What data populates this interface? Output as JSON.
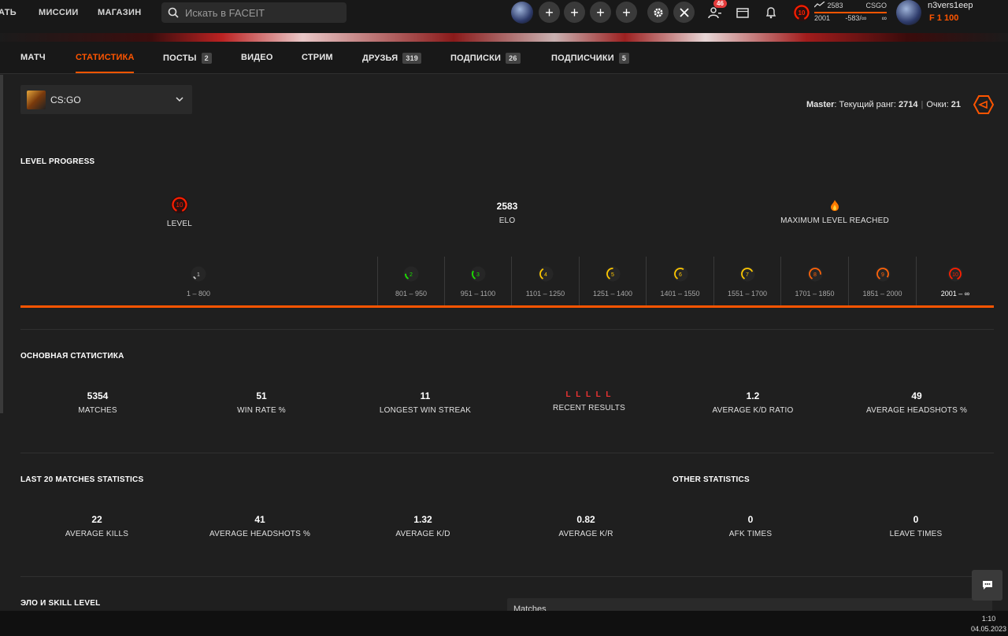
{
  "topnav": {
    "items": [
      "АТЬ",
      "МИССИИ",
      "МАГАЗИН"
    ]
  },
  "search": {
    "placeholder": "Искать в FACEIT"
  },
  "header": {
    "friends_badge": "46",
    "elo_mini": {
      "elo": "2583",
      "game": "CSGO",
      "level_min": "2001",
      "diff": "-583/∞",
      "inf": "∞",
      "level": "10"
    },
    "username": "n3vers1eep",
    "points": "1 100"
  },
  "tabs": [
    {
      "label": "МАТЧ"
    },
    {
      "label": "СТАТИСТИКА",
      "active": true
    },
    {
      "label": "ПОСТЫ",
      "count": "2"
    },
    {
      "label": "ВИДЕО"
    },
    {
      "label": "СТРИМ"
    },
    {
      "label": "ДРУЗЬЯ",
      "count": "319"
    },
    {
      "label": "ПОДПИСКИ",
      "count": "26"
    },
    {
      "label": "ПОДПИСЧИКИ",
      "count": "5"
    }
  ],
  "game_select": {
    "value": "CS:GO"
  },
  "rank": {
    "title": "Master",
    "current_label": "Текущий ранг:",
    "current": "2714",
    "points_label": "Очки:",
    "points": "21"
  },
  "level_progress": {
    "title": "LEVEL PROGRESS",
    "level_value": "10",
    "level_label": "LEVEL",
    "elo_value": "2583",
    "elo_label": "ELO",
    "max_label": "MAXIMUM LEVEL REACHED",
    "levels": [
      {
        "n": "1",
        "range": "1 – 800",
        "color": "#cfcfcf"
      },
      {
        "n": "2",
        "range": "801 – 950",
        "color": "#1ce400"
      },
      {
        "n": "3",
        "range": "951 – 1100",
        "color": "#1ce400"
      },
      {
        "n": "4",
        "range": "1101 – 1250",
        "color": "#ffc800"
      },
      {
        "n": "5",
        "range": "1251 – 1400",
        "color": "#ffc800"
      },
      {
        "n": "6",
        "range": "1401 – 1550",
        "color": "#ffc800"
      },
      {
        "n": "7",
        "range": "1551 – 1700",
        "color": "#ffc800"
      },
      {
        "n": "8",
        "range": "1701 – 1850",
        "color": "#ff6309"
      },
      {
        "n": "9",
        "range": "1851 – 2000",
        "color": "#ff6309"
      },
      {
        "n": "10",
        "range": "2001 – ∞",
        "color": "#fe1f00"
      }
    ]
  },
  "main_stats": {
    "title": "ОСНОВНАЯ СТАТИСТИКА",
    "items": [
      {
        "value": "5354",
        "label": "MATCHES"
      },
      {
        "value": "51",
        "label": "WIN RATE %"
      },
      {
        "value": "11",
        "label": "LONGEST WIN STREAK"
      },
      {
        "value": "L L L L L",
        "label": "RECENT RESULTS"
      },
      {
        "value": "1.2",
        "label": "AVERAGE K/D RATIO"
      },
      {
        "value": "49",
        "label": "AVERAGE HEADSHOTS %"
      }
    ]
  },
  "last20": {
    "title": "LAST 20 MATCHES STATISTICS",
    "items": [
      {
        "value": "22",
        "label": "AVERAGE KILLS"
      },
      {
        "value": "41",
        "label": "AVERAGE HEADSHOTS %"
      },
      {
        "value": "1.32",
        "label": "AVERAGE K/D"
      },
      {
        "value": "0.82",
        "label": "AVERAGE K/R"
      }
    ]
  },
  "other": {
    "title": "OTHER STATISTICS",
    "items": [
      {
        "value": "0",
        "label": "AFK TIMES"
      },
      {
        "value": "0",
        "label": "LEAVE TIMES"
      }
    ]
  },
  "elo_section": {
    "title": "ЭЛО И SKILL LEVEL",
    "select_value": "Matches"
  },
  "taskbar": {
    "time": "1:10",
    "date": "04.05.2023"
  },
  "colors": {
    "accent": "#ff5500",
    "loss": "#e33333"
  }
}
